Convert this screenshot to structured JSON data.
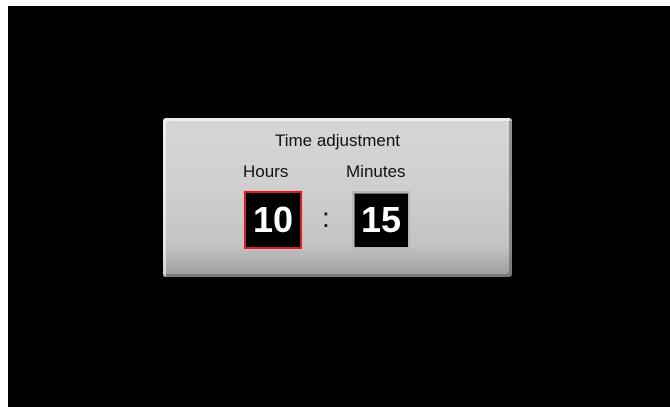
{
  "dialog": {
    "title": "Time adjustment",
    "hours_label": "Hours",
    "minutes_label": "Minutes",
    "hours_value": "10",
    "minutes_value": "15",
    "separator": ":"
  },
  "colors": {
    "screen_background": "#000000",
    "panel_background": "#cfcfcf",
    "selected_field_border": "#c8242b",
    "field_background": "#000000",
    "field_text": "#ffffff"
  }
}
